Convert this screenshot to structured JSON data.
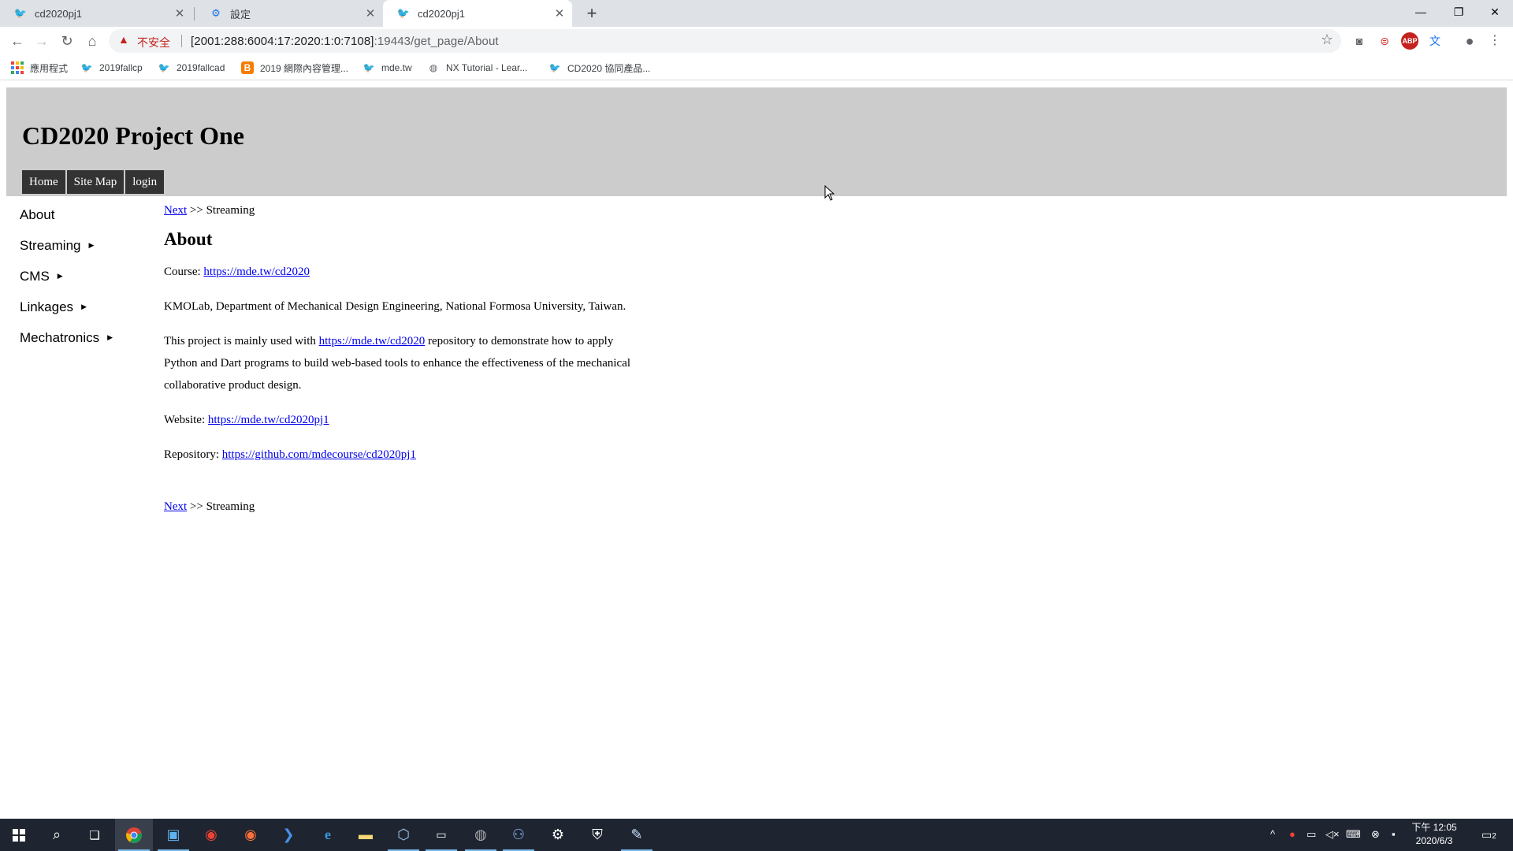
{
  "tabs": [
    {
      "title": "cd2020pj1",
      "icon": "bird-icon"
    },
    {
      "title": "設定",
      "icon": "gear-icon"
    },
    {
      "title": "cd2020pj1",
      "icon": "bird-icon"
    }
  ],
  "window_controls": {
    "minimize": "—",
    "maximize": "❐",
    "close": "✕"
  },
  "address_bar": {
    "security_label": "不安全",
    "url_host": "[2001:288:6004:17:2020:1:0:7108]",
    "url_rest": ":19443/get_page/About"
  },
  "bookmarks": [
    {
      "label": "應用程式",
      "icon": "apps-icon"
    },
    {
      "label": "2019fallcp",
      "icon": "bird-icon"
    },
    {
      "label": "2019fallcad",
      "icon": "bird-icon"
    },
    {
      "label": "2019 網際內容管理...",
      "icon": "blogger-icon"
    },
    {
      "label": "mde.tw",
      "icon": "bird-icon"
    },
    {
      "label": "NX Tutorial - Lear...",
      "icon": "globe-icon"
    },
    {
      "label": "CD2020 協同產品...",
      "icon": "bird-icon"
    }
  ],
  "site": {
    "title": "CD2020 Project One",
    "nav": [
      "Home",
      "Site Map",
      "login"
    ]
  },
  "sidebar": {
    "items": [
      {
        "label": "About",
        "has_submenu": false
      },
      {
        "label": "Streaming",
        "has_submenu": true
      },
      {
        "label": "CMS",
        "has_submenu": true
      },
      {
        "label": "Linkages",
        "has_submenu": true
      },
      {
        "label": "Mechatronics",
        "has_submenu": true
      }
    ]
  },
  "content": {
    "crumb_link": "Next",
    "crumb_rest": " >> Streaming",
    "heading": "About",
    "course_label": "Course: ",
    "course_link": "https://mde.tw/cd2020",
    "affiliation": "KMOLab, Department of Mechanical Design Engineering, National Formosa University, Taiwan.",
    "desc_prefix": "This project is mainly used with ",
    "desc_link": "https://mde.tw/cd2020",
    "desc_suffix": " repository to demonstrate how to apply Python and Dart programs to build web-based tools to enhance the effectiveness of the mechanical collaborative product design.",
    "website_label": "Website: ",
    "website_link": "https://mde.tw/cd2020pj1",
    "repo_label": "Repository: ",
    "repo_link": "https://github.com/mdecourse/cd2020pj1"
  },
  "taskbar": {
    "clock_time": "下午 12:05",
    "clock_date": "2020/6/3",
    "notification_count": "2"
  },
  "colors": {
    "header_bg": "#cccccc",
    "nav_bg": "#333333",
    "link": "#0000ee",
    "taskbar_bg": "#1f2530"
  }
}
